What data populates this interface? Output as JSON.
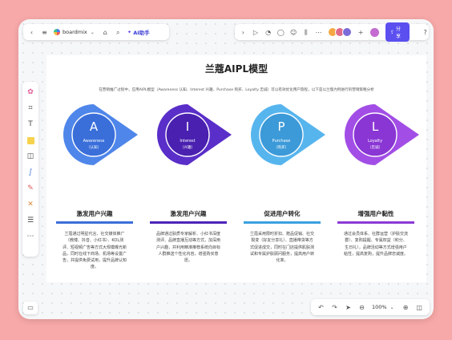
{
  "toolbar": {
    "app_name": "boardmix",
    "ai_label": "AI助手",
    "share_label": "分享"
  },
  "icons": {
    "back": "chevron-left-icon",
    "menu": "menu-icon",
    "tag": "tag-icon",
    "search": "search-icon"
  },
  "zoom": {
    "level": "100%"
  },
  "document": {
    "title": "兰蔻AIPL模型",
    "subtitle": "在营销推广过程中，应用AIPL模型（Awareness 认知、Interest 兴趣、Purchase 购买、Loyalty 忠诚）可以有效优化用户旅程，以下是以兰蔻为例进行的营销策略分析"
  },
  "stages": [
    {
      "letter": "A",
      "name_en": "Awareness",
      "name_cn": "（认知）",
      "title": "激发用户兴趣",
      "color_outer": "#4f86ea",
      "color_inner": "#3a6fda",
      "bar": "#3b6ed8",
      "desc": "兰蔻通过明星代言、社交媒体推广（微博、抖音、小红书）、KOL测评、短视频广告等方式大规模曝光新品，同时在线下商场、机场等设置广告，并提供免费试用，提升品牌认知度。"
    },
    {
      "letter": "I",
      "name_en": "Interest",
      "name_cn": "（兴趣）",
      "title": "激发用户兴趣",
      "color_outer": "#5a2ec8",
      "color_inner": "#4a20b0",
      "bar": "#4b24b8",
      "desc": "品牌通过肤质专家解析、小红书深度测评、品牌直播互动等方式，加深用户兴趣，并利用精准推荐系统向目标人群推送个性化内容，增强购买意愿。"
    },
    {
      "letter": "P",
      "name_en": "Purchase",
      "name_cn": "（购买）",
      "title": "促进用户转化",
      "color_outer": "#57b5ee",
      "color_inner": "#3c9ad8",
      "bar": "#3aa0e0",
      "desc": "兰蔻采用限时折扣、赠品促销、社交裂变（好友分享礼）、直播带货等方式促进成交，同时在门店提供肌肤测试和专属护肤顾问服务，提高用户转化率。"
    },
    {
      "letter": "L",
      "name_en": "Loyalty",
      "name_cn": "（忠诚）",
      "title": "增强用户黏性",
      "color_outer": "#a24ee6",
      "color_inner": "#8a36d4",
      "bar": "#8c3ad6",
      "desc": "通过会员体系、社群运营（护肤交流群）、复购提醒、专属权益（积分、生日礼），品牌活动等方式增强用户粘性，提高复购，提升品牌忠诚度。"
    }
  ]
}
